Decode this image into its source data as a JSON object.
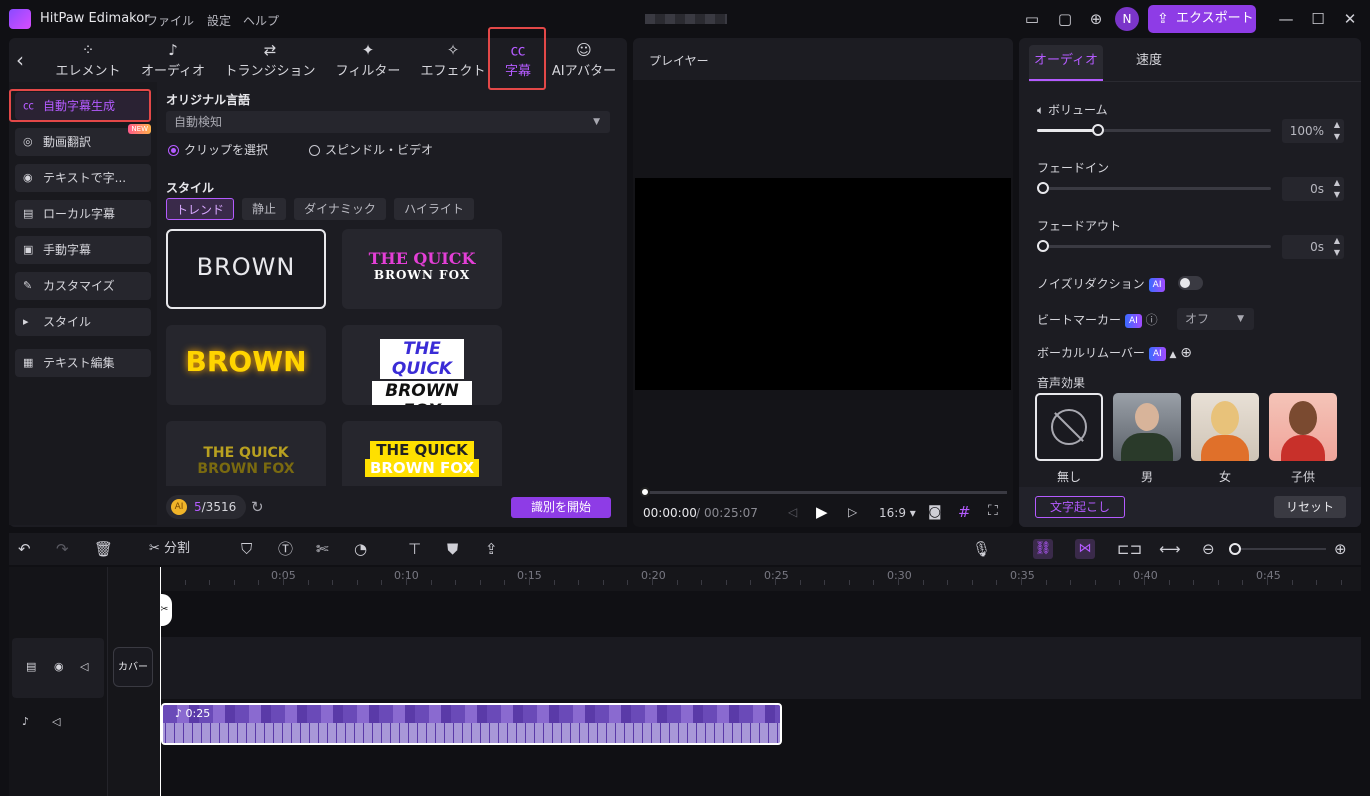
{
  "app": {
    "name": "HitPaw Edimakor",
    "menus": [
      "ファイル",
      "設定",
      "ヘルプ"
    ],
    "avatar": "N",
    "export_label": "エクスポート"
  },
  "top_tabs": [
    {
      "icon": "element-icon",
      "glyph": "⁘",
      "label": "エレメント"
    },
    {
      "icon": "audio-icon",
      "glyph": "♪",
      "label": "オーディオ"
    },
    {
      "icon": "transition-icon",
      "glyph": "⇄",
      "label": "トランジション"
    },
    {
      "icon": "filter-icon",
      "glyph": "✦",
      "label": "フィルター"
    },
    {
      "icon": "effect-icon",
      "glyph": "✧",
      "label": "エフェクト"
    },
    {
      "icon": "caption-icon",
      "glyph": "㏄",
      "label": "字幕",
      "active": true
    },
    {
      "icon": "ai-avatar-icon",
      "glyph": "☺",
      "label": "AIアバター"
    }
  ],
  "sidebar": {
    "items": [
      {
        "label": "自動字幕生成",
        "icon": "cc-icon",
        "active": true
      },
      {
        "label": "動画翻訳",
        "icon": "translate-icon",
        "badge": "NEW"
      },
      {
        "label": "テキストで字...",
        "icon": "text-to-caption-icon"
      },
      {
        "label": "ローカル字幕",
        "icon": "local-caption-icon"
      },
      {
        "label": "手動字幕",
        "icon": "manual-caption-icon"
      },
      {
        "label": "カスタマイズ",
        "icon": "customize-icon"
      },
      {
        "label": "スタイル",
        "icon": "chevron-right-icon"
      },
      {
        "label": "テキスト編集",
        "icon": "text-edit-icon"
      }
    ]
  },
  "caption_panel": {
    "lang_label": "オリジナル言語",
    "lang_value": "自動検知",
    "radio_clip": "クリップを選択",
    "radio_spindle": "スピンドル・ビデオ",
    "style_label": "スタイル",
    "chips": [
      "トレンド",
      "静止",
      "ダイナミック",
      "ハイライト"
    ],
    "cards": [
      {
        "line1": "BROWN",
        "line2": ""
      },
      {
        "line1": "THE QUICK",
        "line2": "BROWN FOX"
      },
      {
        "line1": "BROWN",
        "line2": ""
      },
      {
        "line1": "THE QUICK",
        "line2": "BROWN FOX"
      },
      {
        "line1": "THE QUICK",
        "line2": "BROWN FOX"
      },
      {
        "line1": "THE QUICK",
        "line2": "BROWN FOX"
      }
    ],
    "credits_prefix": "5",
    "credits_total": "/3516",
    "start_button": "識別を開始"
  },
  "player": {
    "title": "プレイヤー",
    "current_time": "00:00:00",
    "separator": "/",
    "total_time": "00:25:07",
    "aspect": "16:9"
  },
  "right_panel": {
    "tabs": [
      "オーディオ",
      "速度"
    ],
    "volume_label": "ボリューム",
    "volume_value": "100%",
    "volume_level": 0.26,
    "fadein_label": "フェードイン",
    "fadein_value": "0s",
    "fadeout_label": "フェードアウト",
    "fadeout_value": "0s",
    "noise_label": "ノイズリダクション",
    "beat_label": "ビートマーカー",
    "beat_value": "オフ",
    "vocal_label": "ボーカルリムーバー",
    "ai_badge": "AI",
    "voice_label": "音声効果",
    "voices": [
      "無し",
      "男",
      "女",
      "子供"
    ],
    "transcribe_button": "文字起こし",
    "reset_button": "リセット"
  },
  "timeline": {
    "split_label": "分割",
    "ruler": [
      "0:05",
      "0:10",
      "0:15",
      "0:20",
      "0:25",
      "0:30",
      "0:35",
      "0:40",
      "0:45"
    ],
    "cover_label": "カバー",
    "clip_duration": "0:25"
  },
  "colors": {
    "accent": "#b45bff",
    "export": "#8e3ce6",
    "highlight": "#e34848"
  }
}
